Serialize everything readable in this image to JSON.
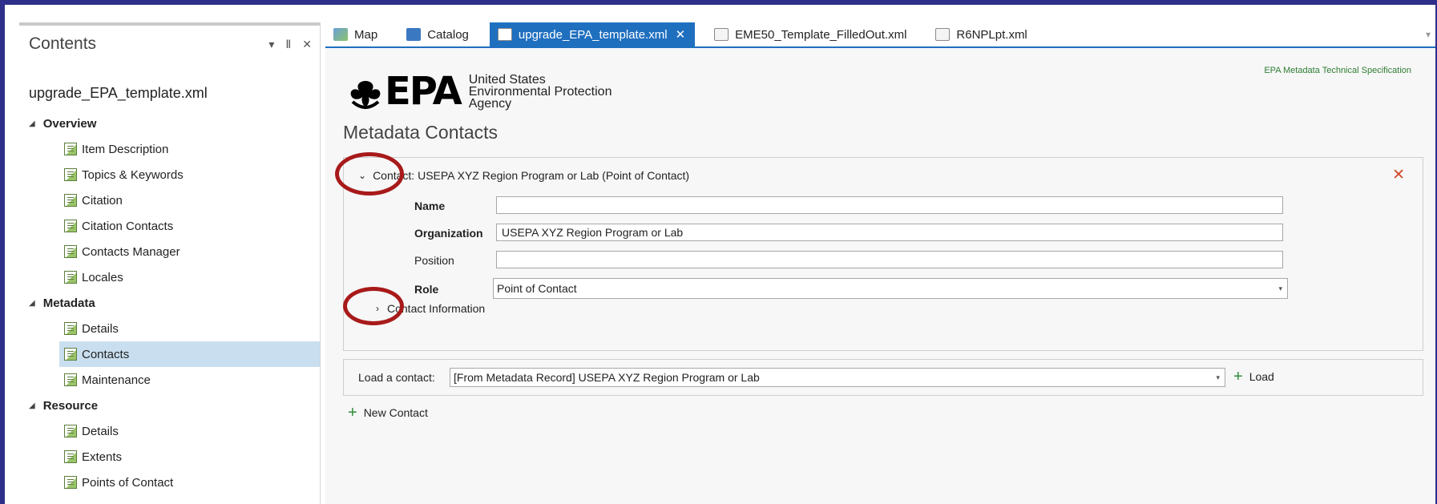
{
  "contents": {
    "title": "Contents",
    "pin": "↓ ⭣ ✕",
    "item_title": "upgrade_EPA_template.xml",
    "groups": [
      {
        "label": "Overview",
        "items": [
          "Item Description",
          "Topics & Keywords",
          "Citation",
          "Citation Contacts",
          "Contacts Manager",
          "Locales"
        ]
      },
      {
        "label": "Metadata",
        "items": [
          "Details",
          "Contacts",
          "Maintenance"
        ]
      },
      {
        "label": "Resource",
        "items": [
          "Details",
          "Extents",
          "Points of Contact"
        ]
      }
    ],
    "selected_item": "Contacts"
  },
  "tabs": [
    {
      "label": "Map",
      "icon": "map-icon",
      "active": false
    },
    {
      "label": "Catalog",
      "icon": "catalog-icon",
      "active": false
    },
    {
      "label": "upgrade_EPA_template.xml",
      "icon": "xml-doc-icon",
      "active": true
    },
    {
      "label": "EME50_Template_FilledOut.xml",
      "icon": "xml-doc-icon",
      "active": false
    },
    {
      "label": "R6NPLpt.xml",
      "icon": "xml-doc-icon",
      "active": false
    }
  ],
  "epa": {
    "mark": "EPA",
    "line1": "United States",
    "line2": "Environmental Protection",
    "line3": "Agency",
    "spec_link": "EPA Metadata Technical Specification"
  },
  "section_title": "Metadata Contacts",
  "contact": {
    "header": "Contact:  USEPA XYZ Region Program or Lab (Point of Contact)",
    "name_label": "Name",
    "name_value": "",
    "org_label": "Organization",
    "org_value": "USEPA XYZ Region Program or Lab",
    "position_label": "Position",
    "position_value": "",
    "role_label": "Role",
    "role_value": "Point of Contact",
    "contact_info_label": "Contact Information"
  },
  "load": {
    "label": "Load a contact:",
    "value": "[From Metadata Record]   USEPA XYZ Region Program or Lab",
    "button": "Load"
  },
  "new_contact": "New Contact",
  "colors": {
    "accent": "#1f6fbf",
    "highlight_ring": "#a81a1a",
    "plus": "#2e8b3a",
    "close": "#d04a2a"
  }
}
